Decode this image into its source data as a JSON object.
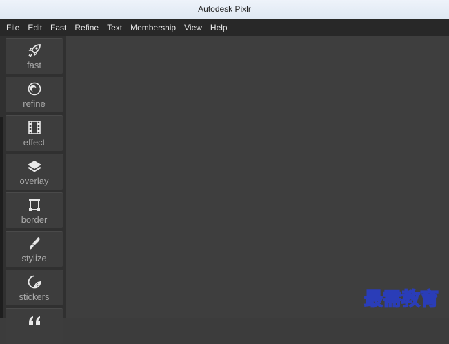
{
  "window": {
    "title": "Autodesk Pixlr"
  },
  "menu": [
    "File",
    "Edit",
    "Fast",
    "Refine",
    "Text",
    "Membership",
    "View",
    "Help"
  ],
  "tools": [
    {
      "label": "fast",
      "icon": "rocket-icon"
    },
    {
      "label": "refine",
      "icon": "circles-icon"
    },
    {
      "label": "effect",
      "icon": "film-icon"
    },
    {
      "label": "overlay",
      "icon": "layers-icon"
    },
    {
      "label": "border",
      "icon": "frame-icon"
    },
    {
      "label": "stylize",
      "icon": "brush-icon"
    },
    {
      "label": "stickers",
      "icon": "sticker-icon"
    },
    {
      "label": "",
      "icon": "quote-icon"
    }
  ],
  "watermark": "最需教育",
  "colors": {
    "menubar": "#282828",
    "sidebar": "#303030",
    "tool": "#3d3d3d",
    "canvas": "#3e3e3e"
  }
}
